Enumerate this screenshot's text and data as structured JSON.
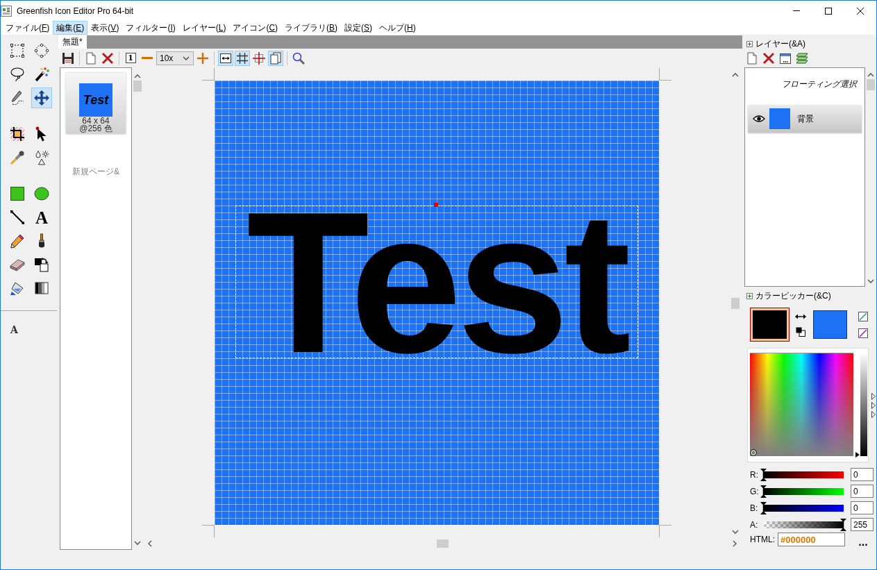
{
  "window": {
    "title": "Greenfish Icon Editor Pro 64-bit"
  },
  "menu": [
    {
      "label": "ファイル(F)",
      "selected": false
    },
    {
      "label": "編集(E)",
      "selected": true
    },
    {
      "label": "表示(V)",
      "selected": false
    },
    {
      "label": "フィルター(I)",
      "selected": false
    },
    {
      "label": "レイヤー(L)",
      "selected": false
    },
    {
      "label": "アイコン(C)",
      "selected": false
    },
    {
      "label": "ライブラリ(B)",
      "selected": false
    },
    {
      "label": "設定(S)",
      "selected": false
    },
    {
      "label": "ヘルプ(H)",
      "selected": false
    }
  ],
  "tool_groups": [
    {
      "tools": [
        {
          "kind": "marquee",
          "selected": false
        },
        {
          "kind": "ellipse",
          "selected": false
        },
        {
          "kind": "lasso",
          "selected": false
        },
        {
          "kind": "wand",
          "selected": false
        },
        {
          "kind": "freehand",
          "selected": false
        },
        {
          "kind": "move",
          "selected": true
        }
      ]
    },
    {
      "tools": [
        {
          "kind": "crop",
          "selected": false
        },
        {
          "kind": "pointer",
          "selected": false
        },
        {
          "kind": "picker",
          "selected": false
        },
        {
          "kind": "effects",
          "selected": false
        }
      ]
    },
    {
      "tools": [
        {
          "kind": "rectangle",
          "selected": false
        },
        {
          "kind": "oval",
          "selected": false
        },
        {
          "kind": "line",
          "selected": false
        },
        {
          "kind": "text",
          "glyph": "A",
          "selected": false
        },
        {
          "kind": "pencil",
          "selected": false
        },
        {
          "kind": "brush",
          "selected": false
        },
        {
          "kind": "eraser",
          "selected": false
        },
        {
          "kind": "replace",
          "selected": false
        },
        {
          "kind": "fill",
          "selected": false
        },
        {
          "kind": "gradient",
          "selected": false
        }
      ]
    }
  ],
  "tool_option": {
    "glyph": "A"
  },
  "tabs": [
    {
      "label": "無題*",
      "selected": true
    }
  ],
  "toolbar": {
    "groups": [
      {
        "buttons": [
          {
            "kind": "save"
          }
        ]
      },
      {
        "buttons": [
          {
            "kind": "new"
          },
          {
            "kind": "delete"
          }
        ]
      },
      {
        "buttons": [
          {
            "kind": "actual",
            "glyph": "1"
          },
          {
            "kind": "zoomout"
          },
          {
            "kind": "zoomselect",
            "value": "10x"
          },
          {
            "kind": "zoomin"
          }
        ]
      }
    ],
    "toggles": [
      {
        "kind": "fit",
        "on": true
      },
      {
        "kind": "grid",
        "on": true
      },
      {
        "kind": "crosshair",
        "on": false
      },
      {
        "kind": "pages",
        "on": true
      }
    ],
    "tools": [
      {
        "kind": "magnifier"
      }
    ]
  },
  "pages": {
    "items": [
      {
        "image_text": "Test",
        "size": "64 x 64",
        "depth": "@256 色"
      }
    ],
    "new_page": "新規ページ&"
  },
  "canvas": {
    "image_text": "Test"
  },
  "layers": {
    "title": "レイヤー(&A)",
    "buttons": [
      {
        "kind": "new"
      },
      {
        "kind": "delete"
      },
      {
        "kind": "properties"
      },
      {
        "kind": "merge"
      }
    ],
    "items": [
      {
        "kind": "floating",
        "label": "フローティング選択",
        "selected": false
      },
      {
        "kind": "bitmap",
        "label": "背景",
        "selected": true
      }
    ]
  },
  "color_picker": {
    "title": "カラーピッカー(&C)",
    "swatches": [
      {
        "kind": "primary",
        "color": "#000000"
      },
      {
        "kind": "secondary",
        "color": "#1c72f2"
      }
    ],
    "channels": [
      {
        "kind": "red",
        "label": "R:",
        "level": 0,
        "value": "0"
      },
      {
        "kind": "green",
        "label": "G:",
        "level": 0,
        "value": "0"
      },
      {
        "kind": "blue",
        "label": "B:",
        "level": 0,
        "value": "0"
      },
      {
        "kind": "alpha",
        "label": "A:",
        "level": 1,
        "value": "255"
      }
    ],
    "html": {
      "label": "HTML:",
      "value": "#000000"
    },
    "more": "..."
  }
}
